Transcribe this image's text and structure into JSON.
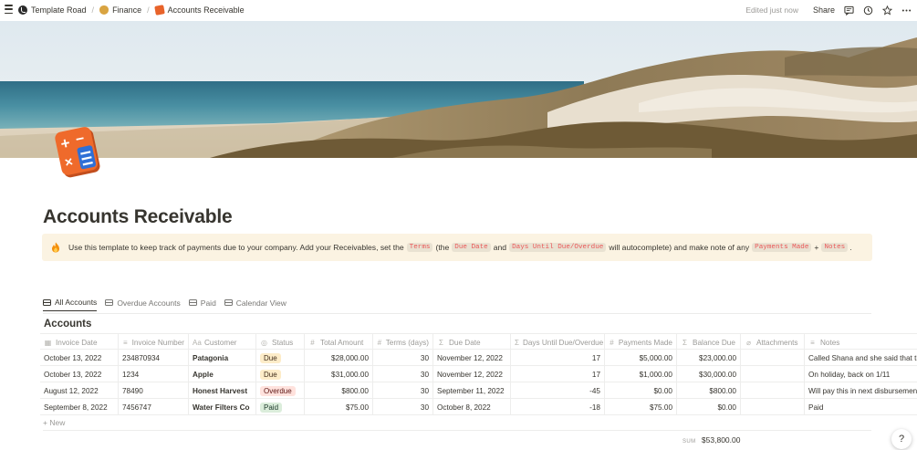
{
  "breadcrumb": {
    "items": [
      {
        "label": "Template Road",
        "icon": "template-road-logo-icon"
      },
      {
        "label": "Finance",
        "icon": "money-bag-icon"
      },
      {
        "label": "Accounts Receivable",
        "icon": "calculator-icon"
      }
    ],
    "separator": "/"
  },
  "topbar": {
    "edited": "Edited just now",
    "share": "Share",
    "icons": [
      "comment-icon",
      "clock-icon",
      "star-icon",
      "more-icon"
    ]
  },
  "page": {
    "title": "Accounts Receivable"
  },
  "callout": {
    "icon": "fire-icon",
    "parts": {
      "t1": "Use this template to keep track of payments due to your company. Add your Receivables, set the",
      "c1": "Terms",
      "t2": "(the",
      "c2": "Due Date",
      "t3": "and",
      "c3": "Days Until Due/Overdue",
      "t4": "will autocomplete) and make note of any",
      "c4": "Payments Made",
      "t5": "+",
      "c5": "Notes",
      "t6": "."
    },
    "bg": "#fbf3e2",
    "code_color": "#eb5757"
  },
  "tabs": [
    {
      "label": "All Accounts",
      "active": true
    },
    {
      "label": "Overdue Accounts",
      "active": false
    },
    {
      "label": "Paid",
      "active": false
    },
    {
      "label": "Calendar View",
      "active": false
    }
  ],
  "database": {
    "title": "Accounts",
    "columns": [
      {
        "label": "Invoice Date",
        "icon": "calendar-icon"
      },
      {
        "label": "Invoice Number",
        "icon": "list-icon"
      },
      {
        "label": "Customer",
        "icon": "text-icon"
      },
      {
        "label": "Status",
        "icon": "status-icon"
      },
      {
        "label": "Total Amount",
        "icon": "number-icon"
      },
      {
        "label": "Terms (days)",
        "icon": "number-icon"
      },
      {
        "label": "Due Date",
        "icon": "formula-icon"
      },
      {
        "label": "Days Until Due/Overdue",
        "icon": "formula-icon"
      },
      {
        "label": "Payments Made",
        "icon": "number-icon"
      },
      {
        "label": "Balance Due",
        "icon": "formula-icon"
      },
      {
        "label": "Attachments",
        "icon": "attachment-icon"
      },
      {
        "label": "Notes",
        "icon": "list-icon"
      }
    ],
    "rows": [
      {
        "invoice_date": "October 13, 2022",
        "invoice_number": "234870934",
        "customer": "Patagonia",
        "status": "Due",
        "total": "$28,000.00",
        "terms": "30",
        "due_date": "November 12, 2022",
        "days": "17",
        "payments": "$5,000.00",
        "balance": "$23,000.00",
        "attachments": "",
        "notes": "Called Shana and she said that they"
      },
      {
        "invoice_date": "October 13, 2022",
        "invoice_number": "1234",
        "customer": "Apple",
        "status": "Due",
        "total": "$31,000.00",
        "terms": "30",
        "due_date": "November 12, 2022",
        "days": "17",
        "payments": "$1,000.00",
        "balance": "$30,000.00",
        "attachments": "",
        "notes": "On holiday, back on 1/11"
      },
      {
        "invoice_date": "August 12, 2022",
        "invoice_number": "78490",
        "customer": "Honest Harvest",
        "status": "Overdue",
        "total": "$800.00",
        "terms": "30",
        "due_date": "September 11, 2022",
        "days": "-45",
        "payments": "$0.00",
        "balance": "$800.00",
        "attachments": "",
        "notes": "Will pay this in next disbursement run"
      },
      {
        "invoice_date": "September 8, 2022",
        "invoice_number": "7456747",
        "customer": "Water Filters Co",
        "status": "Paid",
        "total": "$75.00",
        "terms": "30",
        "due_date": "October 8, 2022",
        "days": "-18",
        "payments": "$75.00",
        "balance": "$0.00",
        "attachments": "",
        "notes": "Paid"
      }
    ],
    "new_label": "+ New",
    "sum_label": "SUM",
    "sum_value": "$53,800.00"
  },
  "help": "?",
  "status_colors": {
    "Due": "#fdecc8",
    "Overdue": "#ffe2dd",
    "Paid": "#dbeddb"
  }
}
